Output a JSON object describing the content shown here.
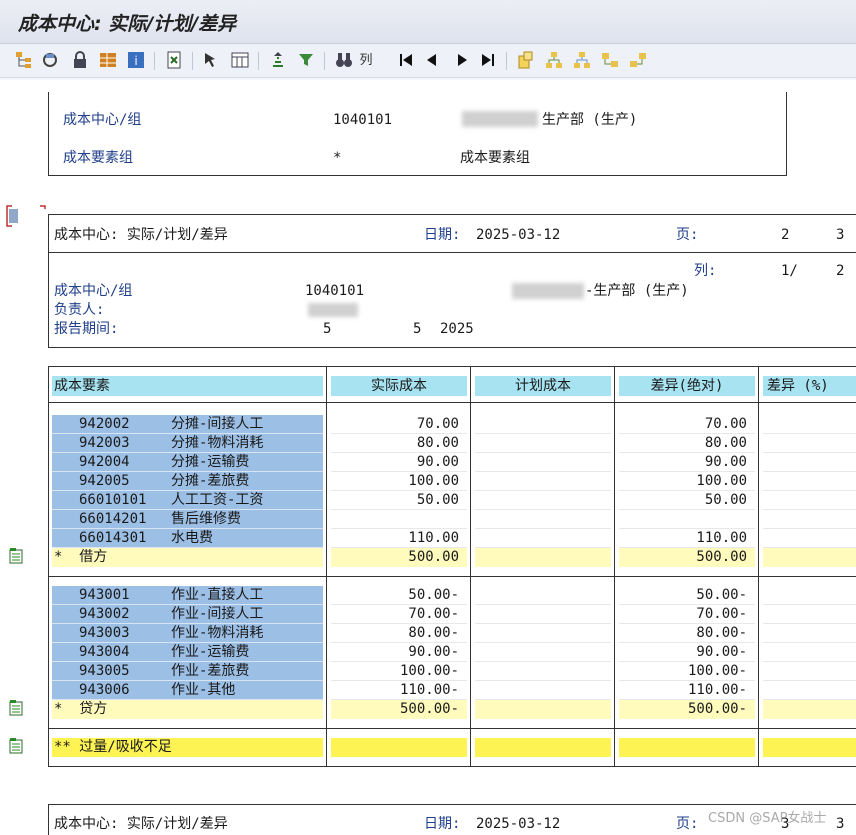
{
  "window": {
    "title": "成本中心: 实际/计划/差异"
  },
  "toolbar": {
    "column_label": "列"
  },
  "selection": {
    "cc_label": "成本中心/组",
    "cc_value": "1040101",
    "cc_name": "生产部 (生产)",
    "ce_label": "成本要素组",
    "ce_value": "*",
    "ce_name": "成本要素组"
  },
  "page_header": {
    "title": "成本中心: 实际/计划/差异",
    "date_label": "日期:",
    "date": "2025-03-12",
    "page_label": "页:",
    "page_num": "2",
    "page_total": "3",
    "col_label": "列:",
    "col_num": "1/",
    "col_total": "2",
    "cc_label": "成本中心/组",
    "cc_value": "1040101",
    "cc_name": "-生产部 (生产)",
    "owner_label": "负责人:",
    "period_label": "报告期间:",
    "period_from": "5",
    "period_to": "5",
    "year": "2025"
  },
  "columns": {
    "element": "成本要素",
    "actual": "实际成本",
    "plan": "计划成本",
    "var_abs": "差异(绝对)",
    "var_pct": "差异 (%)"
  },
  "debit_rows": [
    {
      "code": "942002",
      "name": "分摊-间接人工",
      "actual": "70.00",
      "variance": "70.00"
    },
    {
      "code": "942003",
      "name": "分摊-物料消耗",
      "actual": "80.00",
      "variance": "80.00"
    },
    {
      "code": "942004",
      "name": "分摊-运输费",
      "actual": "90.00",
      "variance": "90.00"
    },
    {
      "code": "942005",
      "name": "分摊-差旅费",
      "actual": "100.00",
      "variance": "100.00"
    },
    {
      "code": "66010101",
      "name": "人工工资-工资",
      "actual": "50.00",
      "variance": "50.00"
    },
    {
      "code": "66014201",
      "name": "售后维修费",
      "actual": "",
      "variance": ""
    },
    {
      "code": "66014301",
      "name": "水电费",
      "actual": "110.00",
      "variance": "110.00"
    }
  ],
  "debit_total": {
    "label": "*  借方",
    "actual": "500.00",
    "variance": "500.00"
  },
  "credit_rows": [
    {
      "code": "943001",
      "name": "作业-直接人工",
      "actual": "50.00-",
      "variance": "50.00-"
    },
    {
      "code": "943002",
      "name": "作业-间接人工",
      "actual": "70.00-",
      "variance": "70.00-"
    },
    {
      "code": "943003",
      "name": "作业-物料消耗",
      "actual": "80.00-",
      "variance": "80.00-"
    },
    {
      "code": "943004",
      "name": "作业-运输费",
      "actual": "90.00-",
      "variance": "90.00-"
    },
    {
      "code": "943005",
      "name": "作业-差旅费",
      "actual": "100.00-",
      "variance": "100.00-"
    },
    {
      "code": "943006",
      "name": "作业-其他",
      "actual": "110.00-",
      "variance": "110.00-"
    }
  ],
  "credit_total": {
    "label": "*  贷方",
    "actual": "500.00-",
    "variance": "500.00-"
  },
  "grand_total": {
    "label": "** 过量/吸收不足"
  },
  "next_page": {
    "title": "成本中心: 实际/计划/差异",
    "date_label": "日期:",
    "date": "2025-03-12",
    "page_label": "页:",
    "page_num": "3",
    "page_total": "3"
  },
  "watermark": "CSDN @SAP女战士"
}
